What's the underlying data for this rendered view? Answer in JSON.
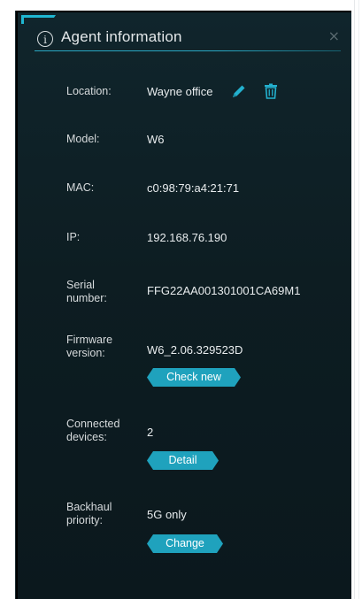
{
  "dialog": {
    "title": "Agent information",
    "close_glyph": "×",
    "info_glyph": "i"
  },
  "fields": {
    "location": {
      "label": "Location:",
      "value": "Wayne office"
    },
    "model": {
      "label": "Model:",
      "value": "W6"
    },
    "mac": {
      "label": "MAC:",
      "value": "c0:98:79:a4:21:71"
    },
    "ip": {
      "label": "IP:",
      "value": "192.168.76.190"
    },
    "serial": {
      "label": "Serial number:",
      "value": "FFG22AA001301001CA69M1"
    },
    "firmware": {
      "label": "Firmware version:",
      "value": "W6_2.06.329523D",
      "button": "Check new"
    },
    "connected": {
      "label": "Connected devices:",
      "value": "2",
      "button": "Detail"
    },
    "backhaul": {
      "label": "Backhaul priority:",
      "value": "5G only",
      "button": "Change"
    }
  },
  "icons": {
    "edit": "pencil-icon",
    "delete": "trash-icon",
    "info": "info-icon",
    "close": "close-icon"
  },
  "colors": {
    "accent": "#1fa2bd",
    "panel_bg": "#0d1d22",
    "text": "#e8ecee"
  }
}
